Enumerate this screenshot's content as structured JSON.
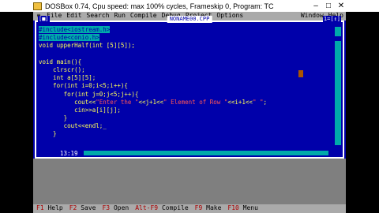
{
  "window": {
    "title": "DOSBox 0.74, Cpu speed: max 100% cycles, Frameskip  0, Program:    TC",
    "icon": "dosbox-icon",
    "minimize": "–",
    "maximize": "□",
    "close": "✕"
  },
  "menu": {
    "system_icon": "≡",
    "items": [
      "File",
      "Edit",
      "Search",
      "Run",
      "Compile",
      "Debug",
      "Project",
      "Options",
      "Window",
      "Help"
    ]
  },
  "editor": {
    "close_box": "[■]",
    "filename": "NONAME00.CPP",
    "window_number": "1=[↕]",
    "cursor_position": "13:19",
    "lines": [
      {
        "text": "#include<iostream.h>",
        "selected": true
      },
      {
        "text": "#include<conio.h>",
        "selected": true
      },
      {
        "text": "void upperHalf(int [5][5]);",
        "selected": false
      },
      {
        "text": "",
        "selected": false
      },
      {
        "text": "void main(){",
        "selected": false
      },
      {
        "text": "    clrscr();",
        "selected": false
      },
      {
        "text": "    int a[5][5];",
        "selected": false
      },
      {
        "text": "    for(int i=0;i<5;i++){",
        "selected": false
      },
      {
        "text": "       for(int j=0;j<5;j++){",
        "selected": false
      },
      {
        "text": "          cout<<\"Enter the \"<<j+1<<\" Element of Row \"<<i+1<<\" \";",
        "selected": false
      },
      {
        "text": "          cin>>a[i][j];",
        "selected": false
      },
      {
        "text": "       }",
        "selected": false
      },
      {
        "text": "       cout<<endl;_",
        "selected": false
      },
      {
        "text": "    }",
        "selected": false
      }
    ]
  },
  "status": {
    "items": [
      {
        "key": "F1",
        "label": "Help"
      },
      {
        "key": "F2",
        "label": "Save"
      },
      {
        "key": "F3",
        "label": "Open"
      },
      {
        "key": "Alt-F9",
        "label": "Compile"
      },
      {
        "key": "F9",
        "label": "Make"
      },
      {
        "key": "F10",
        "label": "Menu"
      }
    ]
  },
  "colors": {
    "dos_blue": "#0000aa",
    "menu_gray": "#aaaaaa",
    "code_yellow": "#ffff55",
    "string_red": "#ff5555",
    "selection_cyan": "#00aaaa"
  }
}
